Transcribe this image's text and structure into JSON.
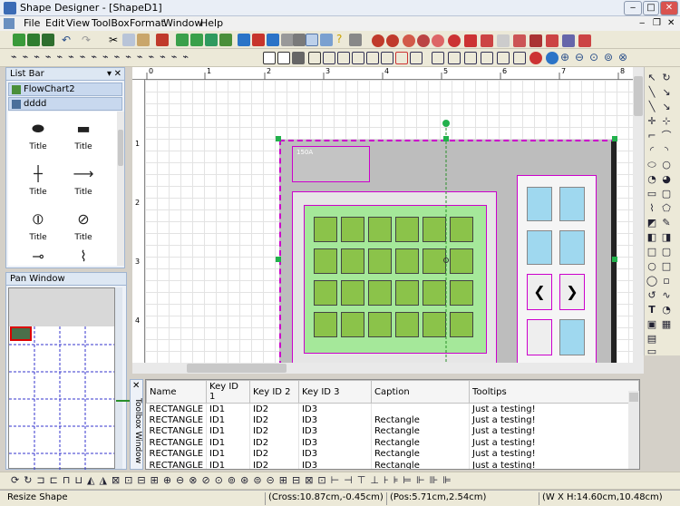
{
  "window": {
    "title": "Shape Designer - [ShapeD1]"
  },
  "menu": [
    {
      "label": "File"
    },
    {
      "label": "Edit"
    },
    {
      "label": "View"
    },
    {
      "label": "ToolBox"
    },
    {
      "label": "Format"
    },
    {
      "label": "Window"
    },
    {
      "label": "Help"
    }
  ],
  "listbar": {
    "title": "List Bar",
    "groups": [
      "FlowChart2",
      "dddd"
    ],
    "shapes": [
      {
        "label": "Title",
        "icon": "ellipse-flat-icon"
      },
      {
        "label": "Title",
        "icon": "tape-icon"
      },
      {
        "label": "Title",
        "icon": "vertical-connector-icon"
      },
      {
        "label": "Title",
        "icon": "arrow-connector-icon"
      },
      {
        "label": "Title",
        "icon": "node-connector-icon"
      },
      {
        "label": "Title",
        "icon": "circle-connector-icon"
      }
    ]
  },
  "panwindow": {
    "title": "Pan Window"
  },
  "toolbox_side": {
    "title": "Toolbox Window"
  },
  "canvas": {
    "ruler_top": [
      "0",
      "1",
      "2",
      "3",
      "4",
      "5",
      "6",
      "7",
      "8"
    ],
    "ruler_left": [
      "1",
      "2",
      "3",
      "4"
    ],
    "label": "150A"
  },
  "props_table": {
    "headers": [
      "Name",
      "Key ID 1",
      "Key ID 2",
      "Key ID 3",
      "Caption",
      "Tooltips"
    ],
    "rows": [
      [
        "RECTANGLE",
        "ID1",
        "ID2",
        "ID3",
        "",
        "Just a testing!"
      ],
      [
        "RECTANGLE",
        "ID1",
        "ID2",
        "ID3",
        "Rectangle",
        "Just a testing!"
      ],
      [
        "RECTANGLE",
        "ID1",
        "ID2",
        "ID3",
        "Rectangle",
        "Just a testing!"
      ],
      [
        "RECTANGLE",
        "ID1",
        "ID2",
        "ID3",
        "Rectangle",
        "Just a testing!"
      ],
      [
        "RECTANGLE",
        "ID1",
        "ID2",
        "ID3",
        "Rectangle",
        "Just a testing!"
      ],
      [
        "RECTANGLE",
        "ID1",
        "ID2",
        "ID3",
        "Rectangle",
        "Just a testing!"
      ]
    ]
  },
  "status": {
    "left": "Resize Shape",
    "cross": "(Cross:10.87cm,-0.45cm)",
    "pos": "(Pos:5.71cm,2.54cm)",
    "size": "(W X H:14.60cm,10.48cm)"
  },
  "colors": {
    "accent": "#3b6bb5",
    "selection": "#cc00cc",
    "shape_green": "#8bc34a",
    "shape_cyan": "#9fd8ef"
  }
}
